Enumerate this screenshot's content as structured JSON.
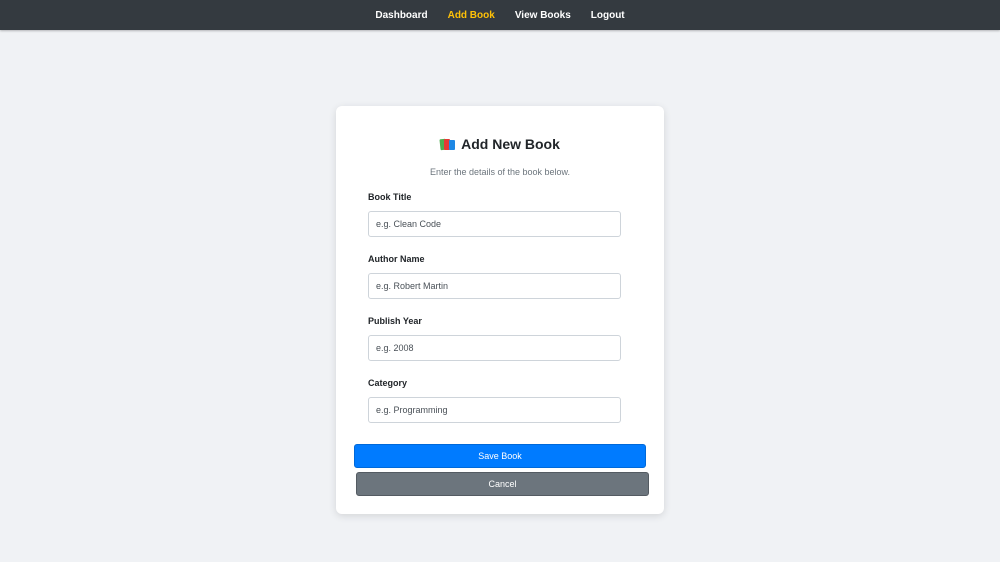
{
  "nav": {
    "items": [
      {
        "label": "Dashboard"
      },
      {
        "label": "Add Book"
      },
      {
        "label": "View Books"
      },
      {
        "label": "Logout"
      }
    ],
    "active_color": "#ffc107",
    "background": "#343a40"
  },
  "form": {
    "icon": "books-icon",
    "title": "Add New Book",
    "subtitle": "Enter the details of the book below.",
    "fields": [
      {
        "label": "Book Title",
        "placeholder": "e.g. Clean Code",
        "value": ""
      },
      {
        "label": "Author Name",
        "placeholder": "e.g. Robert Martin",
        "value": ""
      },
      {
        "label": "Publish Year",
        "placeholder": "e.g. 2008",
        "value": ""
      },
      {
        "label": "Category",
        "placeholder": "e.g. Programming",
        "value": ""
      }
    ],
    "save_label": "Save Book",
    "cancel_label": "Cancel",
    "primary_color": "#007bff",
    "secondary_color": "#6c757d"
  }
}
